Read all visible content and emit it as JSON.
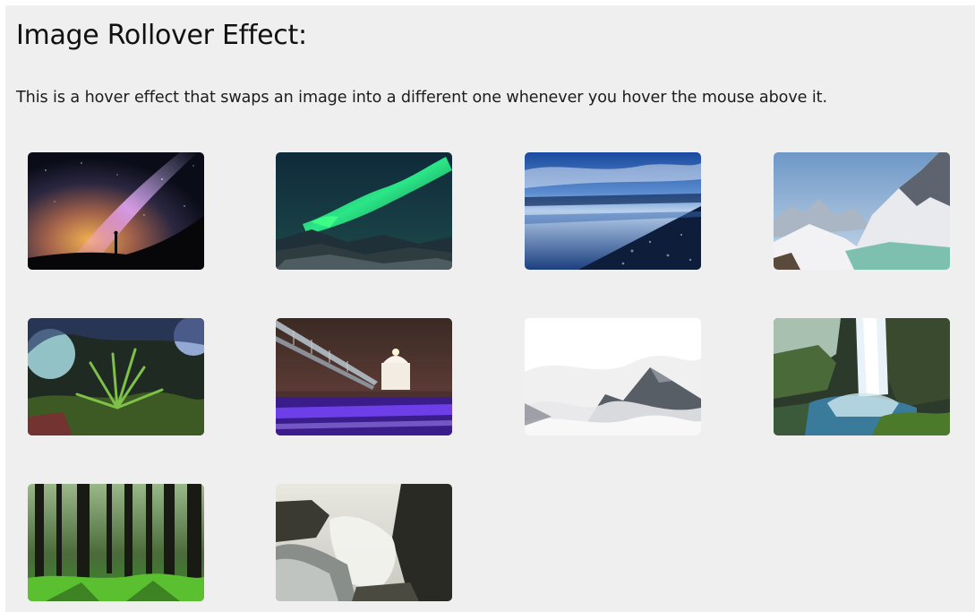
{
  "page": {
    "title": "Image Rollover Effect:",
    "description": "This is a hover effect that swaps an image into a different one whenever you hover the mouse above it."
  },
  "gallery": {
    "images": [
      {
        "subject": "milky-way-night-sky"
      },
      {
        "subject": "aurora-borealis"
      },
      {
        "subject": "blue-coastline-at-dusk"
      },
      {
        "subject": "snowy-mountains-glacier-lake"
      },
      {
        "subject": "fern-in-forest"
      },
      {
        "subject": "bridge-and-cathedral-at-night"
      },
      {
        "subject": "misty-mountain-peaks"
      },
      {
        "subject": "waterfall"
      },
      {
        "subject": "sunlit-forest"
      },
      {
        "subject": "waterfall-canyon-mist"
      }
    ]
  },
  "colors": {
    "background": "#efefef",
    "text": "#111111"
  }
}
